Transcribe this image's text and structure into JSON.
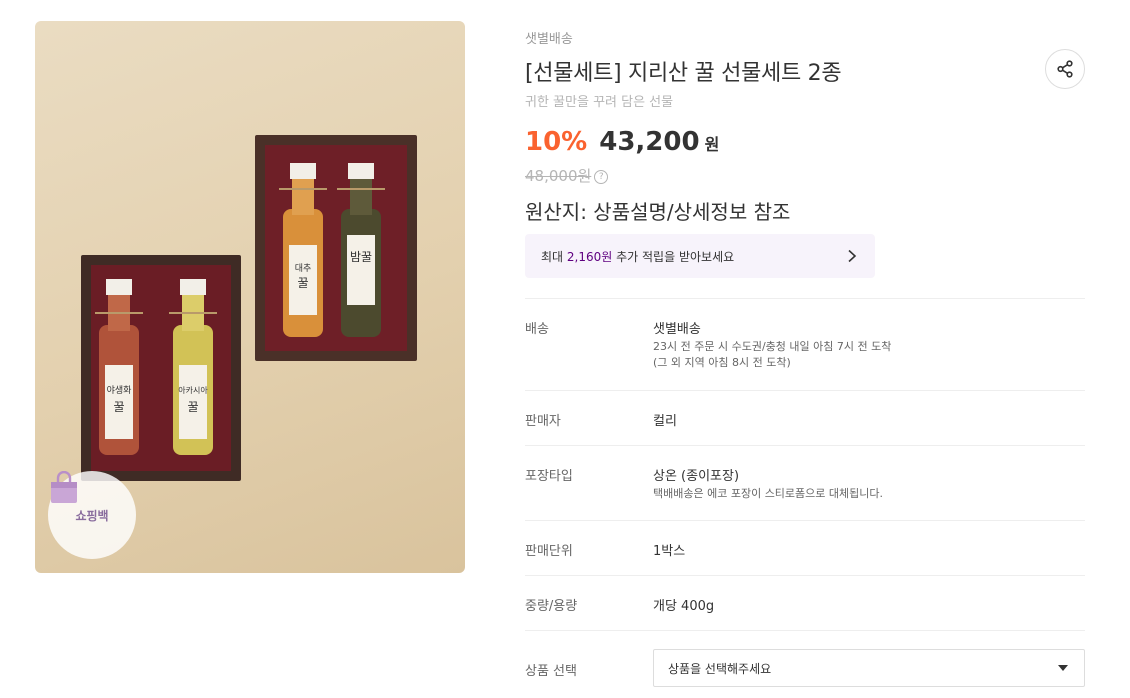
{
  "image": {
    "alt": "지리산 꿀 선물세트",
    "badge_label": "쇼핑백"
  },
  "product": {
    "delivery_type": "샛별배송",
    "title": "[선물세트] 지리산 꿀 선물세트 2종",
    "subtitle": "귀한 꿀만을 꾸려 담은 선물",
    "discount": "10%",
    "price": "43,200",
    "price_unit": "원",
    "original_price": "48,000원",
    "origin": "원산지: 상품설명/상세정보 참조"
  },
  "points": {
    "prefix": "최대 ",
    "amount": "2,160원",
    "suffix": " 추가 적립을 받아보세요"
  },
  "details": {
    "delivery": {
      "label": "배송",
      "value": "샛별배송",
      "note1": "23시 전 주문 시 수도권/충청 내일 아침 7시 전 도착",
      "note2": "(그 외 지역 아침 8시 전 도착)"
    },
    "seller": {
      "label": "판매자",
      "value": "컬리"
    },
    "packaging": {
      "label": "포장타입",
      "value": "상온 (종이포장)",
      "note": "택배배송은 에코 포장이 스티로폼으로 대체됩니다."
    },
    "unit": {
      "label": "판매단위",
      "value": "1박스"
    },
    "weight": {
      "label": "중량/용량",
      "value": "개당 400g"
    },
    "option": {
      "label": "상품 선택",
      "placeholder": "상품을 선택해주세요"
    }
  },
  "icons": {
    "share": "share-icon",
    "help": "question-circle-icon",
    "chevron": "chevron-right-icon",
    "dropdown": "caret-down-icon",
    "bag": "shopping-bag-icon"
  },
  "colors": {
    "discount": "#fa622f",
    "brand_purple": "#5f0080",
    "banner_bg": "#f7f3fb"
  }
}
